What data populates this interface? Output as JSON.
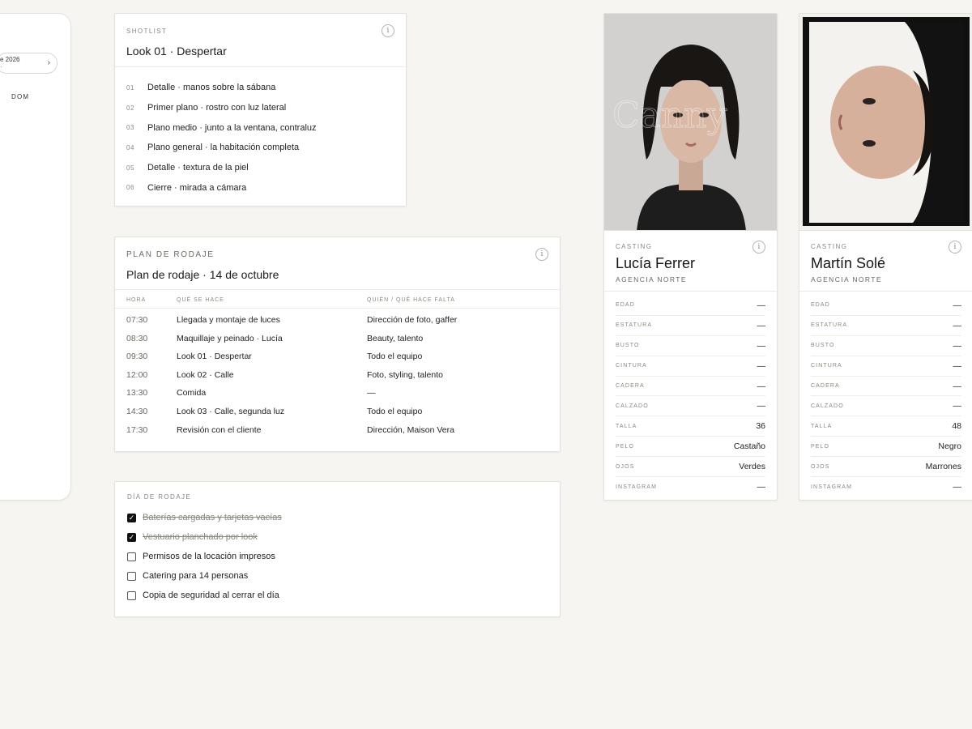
{
  "calendar": {
    "month_label": "e 2026",
    "sub_label": "·",
    "day_label": "DOM"
  },
  "shotlist": {
    "eyebrow": "SHOTLIST",
    "title": "Look 01 · Despertar",
    "info_icon": "info-icon",
    "items": [
      {
        "num": "01",
        "text": "Detalle · manos sobre la sábana"
      },
      {
        "num": "02",
        "text": "Primer plano · rostro con luz lateral"
      },
      {
        "num": "03",
        "text": "Plano medio · junto a la ventana, contraluz"
      },
      {
        "num": "04",
        "text": "Plano general · la habitación completa"
      },
      {
        "num": "05",
        "text": "Detalle · textura de la piel"
      },
      {
        "num": "06",
        "text": "Cierre · mirada a cámara"
      }
    ]
  },
  "plan": {
    "eyebrow": "PLAN DE RODAJE",
    "title": "Plan de rodaje · 14 de octubre",
    "columns": [
      "HORA",
      "QUÉ SE HACE",
      "QUIÉN / QUÉ HACE FALTA"
    ],
    "rows": [
      {
        "time": "07:30",
        "what": "Llegada y montaje de luces",
        "who": "Dirección de foto, gaffer"
      },
      {
        "time": "08:30",
        "what": "Maquillaje y peinado · Lucía",
        "who": "Beauty, talento"
      },
      {
        "time": "09:30",
        "what": "Look 01 · Despertar",
        "who": "Todo el equipo"
      },
      {
        "time": "12:00",
        "what": "Look 02 · Calle",
        "who": "Foto, styling, talento"
      },
      {
        "time": "13:30",
        "what": "Comida",
        "who": "—"
      },
      {
        "time": "14:30",
        "what": "Look 03 · Calle, segunda luz",
        "who": "Todo el equipo"
      },
      {
        "time": "17:30",
        "what": "Revisión con el cliente",
        "who": "Dirección, Maison Vera"
      }
    ]
  },
  "day": {
    "eyebrow": "DÍA DE RODAJE",
    "items": [
      {
        "text": "Baterías cargadas y tarjetas vacías",
        "checked": true
      },
      {
        "text": "Vestuario planchado por look",
        "checked": true
      },
      {
        "text": "Permisos de la locación impresos",
        "checked": false
      },
      {
        "text": "Catering para 14 personas",
        "checked": false
      },
      {
        "text": "Copia de seguridad al cerrar el día",
        "checked": false
      }
    ]
  },
  "casting": [
    {
      "eyebrow": "CASTING",
      "name": "Lucía Ferrer",
      "agency": "AGENCIA NORTE",
      "measures": [
        {
          "label": "EDAD",
          "value": "—"
        },
        {
          "label": "ESTATURA",
          "value": "—"
        },
        {
          "label": "BUSTO",
          "value": "—"
        },
        {
          "label": "CINTURA",
          "value": "—"
        },
        {
          "label": "CADERA",
          "value": "—"
        },
        {
          "label": "CALZADO",
          "value": "—"
        },
        {
          "label": "TALLA",
          "value": "36"
        },
        {
          "label": "PELO",
          "value": "Castaño"
        },
        {
          "label": "OJOS",
          "value": "Verdes"
        },
        {
          "label": "INSTAGRAM",
          "value": "—"
        }
      ]
    },
    {
      "eyebrow": "CASTING",
      "name": "Martín Solé",
      "agency": "AGENCIA NORTE",
      "measures": [
        {
          "label": "EDAD",
          "value": "—"
        },
        {
          "label": "ESTATURA",
          "value": "—"
        },
        {
          "label": "BUSTO",
          "value": "—"
        },
        {
          "label": "CINTURA",
          "value": "—"
        },
        {
          "label": "CADERA",
          "value": "—"
        },
        {
          "label": "CALZADO",
          "value": "—"
        },
        {
          "label": "TALLA",
          "value": "48"
        },
        {
          "label": "PELO",
          "value": "Negro"
        },
        {
          "label": "OJOS",
          "value": "Marrones"
        },
        {
          "label": "INSTAGRAM",
          "value": "—"
        }
      ]
    }
  ]
}
